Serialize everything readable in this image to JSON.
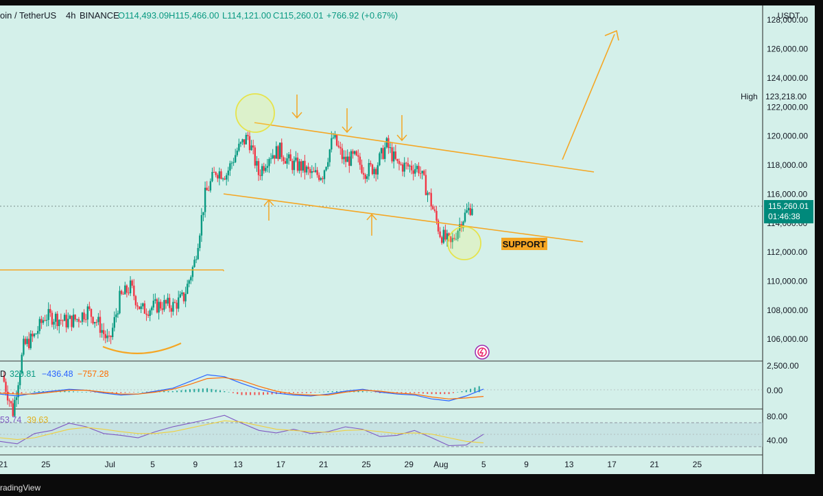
{
  "header": {
    "symbol": "oin / TetherUS",
    "interval": "4h",
    "exchange": "BINANCE",
    "open": "O114,493.09",
    "high": "H115,466.00",
    "low": "L114,121.00",
    "close": "C115,260.01",
    "change": "+766.92 (+0.67%)"
  },
  "axis": {
    "currency": "USDT",
    "price_ticks": [
      "128,000.00",
      "126,000.00",
      "124,000.00",
      "122,000.00",
      "120,000.00",
      "118,000.00",
      "116,000.00",
      "114,000.00",
      "112,000.00",
      "110,000.00",
      "108,000.00",
      "106,000.00"
    ],
    "high_label": "High",
    "high_value": "123,218.00",
    "last_price": "115,260.01",
    "countdown": "01:46:38",
    "macd_ticks": [
      "2,500.00",
      "0.00"
    ],
    "rsi_ticks": [
      "80.00",
      "40.00"
    ],
    "date_ticks": [
      "21",
      "25",
      "Jul",
      "5",
      "9",
      "13",
      "17",
      "21",
      "25",
      "29",
      "Aug",
      "5",
      "9",
      "13",
      "17",
      "21",
      "25"
    ]
  },
  "macd_legend": {
    "prefix": "D",
    "v1": "320.81",
    "v2": "−436.48",
    "v3": "−757.28"
  },
  "rsi_legend": {
    "v1": "53.74",
    "v2": "39.63"
  },
  "annotation": {
    "support_label": "SUPPORT"
  },
  "footer": {
    "brand": "radingView"
  },
  "colors": {
    "background": "#d4f0ea",
    "up": "#089981",
    "down": "#f23645",
    "drawing": "#f5a623",
    "highlight": "#f0e74a",
    "macd_line": "#2962ff",
    "signal_line": "#ff6d00",
    "rsi_line": "#7e57c2",
    "rsi_ma": "#f0d03c",
    "axis_badge": "#00897b"
  },
  "chart_data": [
    {
      "type": "candlestick",
      "title": "oin / TetherUS · 4h · BINANCE",
      "ylabel": "USDT",
      "ylim": [
        104500,
        129000
      ],
      "x_ticks": [
        "21",
        "25",
        "Jul",
        "5",
        "9",
        "13",
        "17",
        "21",
        "25",
        "29",
        "Aug",
        "5",
        "9",
        "13",
        "17",
        "21",
        "25"
      ],
      "last_close": 115260.01,
      "all_time_high": 123218.0,
      "approx_closes_daily": [
        {
          "date": "Jun 21",
          "close": 103500
        },
        {
          "date": "Jun 22",
          "close": 101000
        },
        {
          "date": "Jun 23",
          "close": 105500
        },
        {
          "date": "Jun 24",
          "close": 106200
        },
        {
          "date": "Jun 25",
          "close": 107600
        },
        {
          "date": "Jun 26",
          "close": 107500
        },
        {
          "date": "Jun 27",
          "close": 107200
        },
        {
          "date": "Jun 28",
          "close": 107400
        },
        {
          "date": "Jun 29",
          "close": 108000
        },
        {
          "date": "Jun 30",
          "close": 107100
        },
        {
          "date": "Jul 1",
          "close": 105700
        },
        {
          "date": "Jul 2",
          "close": 108800
        },
        {
          "date": "Jul 3",
          "close": 109600
        },
        {
          "date": "Jul 4",
          "close": 108000
        },
        {
          "date": "Jul 5",
          "close": 108200
        },
        {
          "date": "Jul 6",
          "close": 108400
        },
        {
          "date": "Jul 7",
          "close": 108300
        },
        {
          "date": "Jul 8",
          "close": 108900
        },
        {
          "date": "Jul 9",
          "close": 111300
        },
        {
          "date": "Jul 10",
          "close": 115900
        },
        {
          "date": "Jul 11",
          "close": 117600
        },
        {
          "date": "Jul 12",
          "close": 117400
        },
        {
          "date": "Jul 13",
          "close": 119000
        },
        {
          "date": "Jul 14",
          "close": 120000
        },
        {
          "date": "Jul 15",
          "close": 117400
        },
        {
          "date": "Jul 16",
          "close": 118700
        },
        {
          "date": "Jul 17",
          "close": 119000
        },
        {
          "date": "Jul 18",
          "close": 118100
        },
        {
          "date": "Jul 19",
          "close": 117900
        },
        {
          "date": "Jul 20",
          "close": 117300
        },
        {
          "date": "Jul 21",
          "close": 117400
        },
        {
          "date": "Jul 22",
          "close": 119900
        },
        {
          "date": "Jul 23",
          "close": 118300
        },
        {
          "date": "Jul 24",
          "close": 118500
        },
        {
          "date": "Jul 25",
          "close": 117600
        },
        {
          "date": "Jul 26",
          "close": 117900
        },
        {
          "date": "Jul 27",
          "close": 119400
        },
        {
          "date": "Jul 28",
          "close": 118000
        },
        {
          "date": "Jul 29",
          "close": 117900
        },
        {
          "date": "Jul 30",
          "close": 117800
        },
        {
          "date": "Jul 31",
          "close": 115800
        },
        {
          "date": "Aug 1",
          "close": 113300
        },
        {
          "date": "Aug 2",
          "close": 112500
        },
        {
          "date": "Aug 3",
          "close": 114200
        },
        {
          "date": "Aug 4",
          "close": 115260
        }
      ],
      "annotations": {
        "upper_channel": {
          "from": {
            "date": "Jul 14",
            "price": 121300
          },
          "to": {
            "date": "Aug 13",
            "price": 117800
          }
        },
        "lower_channel": {
          "from": {
            "date": "Jul 10",
            "price": 116100
          },
          "to": {
            "date": "Aug 12",
            "price": 112600
          }
        },
        "resistance_line": {
          "from": {
            "date": "Jun 20",
            "price": 110600
          },
          "to": {
            "date": "Jul 10",
            "price": 110600
          }
        },
        "projection_arrow": {
          "from": {
            "date": "Aug 10",
            "price": 118300
          },
          "to": {
            "date": "Aug 15",
            "price": 127800
          }
        },
        "support_label": "SUPPORT"
      }
    },
    {
      "type": "line",
      "title": "MACD",
      "ylim": [
        -1600,
        3000
      ],
      "series": [
        {
          "name": "MACD",
          "values": [
            -200,
            -400,
            -100,
            100,
            300,
            200,
            -100,
            -300,
            -200,
            100,
            400,
            1100,
            1800,
            1600,
            900,
            300,
            -100,
            -300,
            -400,
            -200,
            100,
            300,
            0,
            -200,
            -300,
            -700,
            -900,
            -400,
            320
          ]
        },
        {
          "name": "Signal",
          "values": [
            -100,
            -200,
            -200,
            0,
            200,
            200,
            0,
            -200,
            -200,
            0,
            300,
            800,
            1400,
            1500,
            1200,
            600,
            100,
            -200,
            -300,
            -300,
            0,
            200,
            100,
            -100,
            -200,
            -500,
            -700,
            -600,
            -436
          ]
        }
      ],
      "legend_values": [
        320.81,
        -436.48,
        -757.28
      ]
    },
    {
      "type": "line",
      "title": "RSI",
      "ylim": [
        22,
        92
      ],
      "series": [
        {
          "name": "RSI",
          "values": [
            42,
            38,
            55,
            60,
            72,
            66,
            55,
            52,
            48,
            58,
            66,
            72,
            78,
            85,
            72,
            60,
            56,
            62,
            55,
            58,
            66,
            62,
            50,
            52,
            60,
            48,
            35,
            36,
            53.74
          ]
        },
        {
          "name": "MA",
          "values": [
            48,
            45,
            48,
            55,
            62,
            65,
            62,
            58,
            55,
            55,
            58,
            64,
            70,
            76,
            74,
            68,
            62,
            60,
            58,
            57,
            60,
            61,
            58,
            55,
            56,
            54,
            48,
            42,
            39.63
          ]
        }
      ],
      "levels": [
        70,
        30
      ],
      "legend_values": [
        53.74,
        39.63
      ]
    }
  ]
}
